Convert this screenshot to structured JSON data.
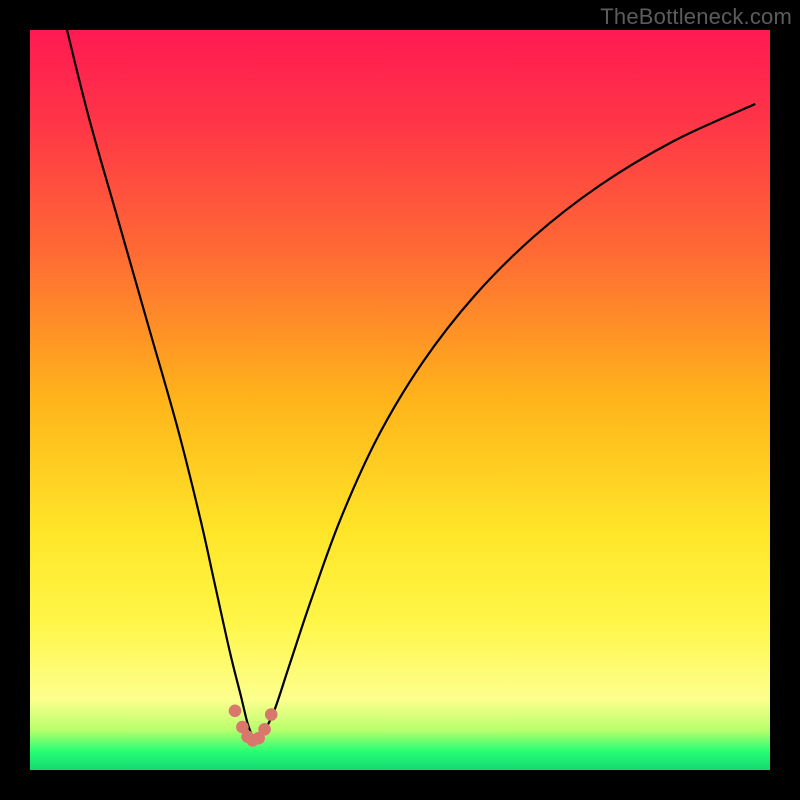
{
  "watermark": "TheBottleneck.com",
  "colors": {
    "frame": "#000000",
    "curve_stroke": "#000000",
    "dot_fill": "#d9776d",
    "gradient_stops": [
      {
        "offset": 0.0,
        "color": "#ff1a52"
      },
      {
        "offset": 0.12,
        "color": "#ff3448"
      },
      {
        "offset": 0.3,
        "color": "#ff6a34"
      },
      {
        "offset": 0.5,
        "color": "#ffb41a"
      },
      {
        "offset": 0.68,
        "color": "#ffe629"
      },
      {
        "offset": 0.8,
        "color": "#fff648"
      },
      {
        "offset": 0.905,
        "color": "#fdff8e"
      },
      {
        "offset": 0.946,
        "color": "#b7ff6c"
      },
      {
        "offset": 0.975,
        "color": "#26fe74"
      },
      {
        "offset": 1.0,
        "color": "#17d773"
      }
    ]
  },
  "chart_data": {
    "type": "line",
    "title": "",
    "xlabel": "",
    "ylabel": "",
    "xlim": [
      0,
      100
    ],
    "ylim": [
      0,
      100
    ],
    "grid": false,
    "legend": false,
    "series": [
      {
        "name": "curve",
        "x": [
          5,
          8,
          12,
          16,
          20,
          23,
          25,
          27,
          28.5,
          29.5,
          30.5,
          31.5,
          33,
          35,
          38,
          42,
          47,
          53,
          60,
          68,
          77,
          87,
          98
        ],
        "y": [
          100,
          88,
          74,
          60,
          46,
          34,
          25,
          16,
          10,
          6,
          4,
          5,
          8,
          14,
          23,
          34,
          45,
          55,
          64,
          72,
          79,
          85,
          90
        ]
      }
    ],
    "markers": {
      "name": "dots-near-trough",
      "x": [
        27.7,
        28.7,
        29.4,
        30.1,
        30.9,
        31.7,
        32.6
      ],
      "y": [
        8.0,
        5.8,
        4.5,
        4.0,
        4.3,
        5.5,
        7.5
      ]
    }
  }
}
